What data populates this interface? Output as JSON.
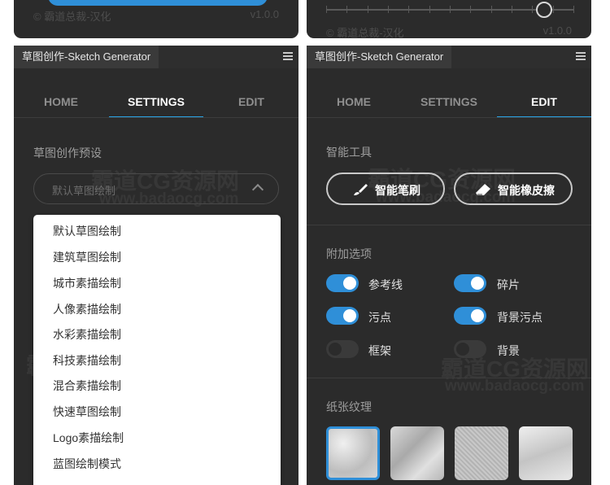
{
  "top_left": {
    "credit": "© 霸道总裁-汉化",
    "version": "v1.0.0"
  },
  "top_right": {
    "credit": "© 霸道总裁-汉化",
    "version": "v1.0.0",
    "slider_value": 0.88
  },
  "left_panel": {
    "title": "草图创作-Sketch Generator",
    "tabs": [
      "HOME",
      "SETTINGS",
      "EDIT"
    ],
    "active_tab": "SETTINGS",
    "section_title": "草图创作预设",
    "select_value": "默认草图绘制",
    "options": [
      "默认草图绘制",
      "建筑草图绘制",
      "城市素描绘制",
      "人像素描绘制",
      "水彩素描绘制",
      "科技素描绘制",
      "混合素描绘制",
      "快速草图绘制",
      "Logo素描绘制",
      "蓝图绘制模式"
    ]
  },
  "right_panel": {
    "title": "草图创作-Sketch Generator",
    "tabs": [
      "HOME",
      "SETTINGS",
      "EDIT"
    ],
    "active_tab": "EDIT",
    "tools_title": "智能工具",
    "brush_label": "智能笔刷",
    "eraser_label": "智能橡皮擦",
    "options_title": "附加选项",
    "toggles": [
      {
        "label": "参考线",
        "on": true
      },
      {
        "label": "碎片",
        "on": true
      },
      {
        "label": "污点",
        "on": true
      },
      {
        "label": "背景污点",
        "on": true
      },
      {
        "label": "框架",
        "on": false
      },
      {
        "label": "背景",
        "on": false
      }
    ],
    "paper_title": "纸张纹理",
    "selected_texture": 1
  },
  "watermark": {
    "cn": "霸道CG资源网",
    "url": "www.badaocg.com"
  },
  "colors": {
    "panel": "#2b2b2b",
    "accent": "#2aa6e8",
    "toggle_on": "#2f8fd8",
    "text_muted": "#9d9d9d"
  }
}
